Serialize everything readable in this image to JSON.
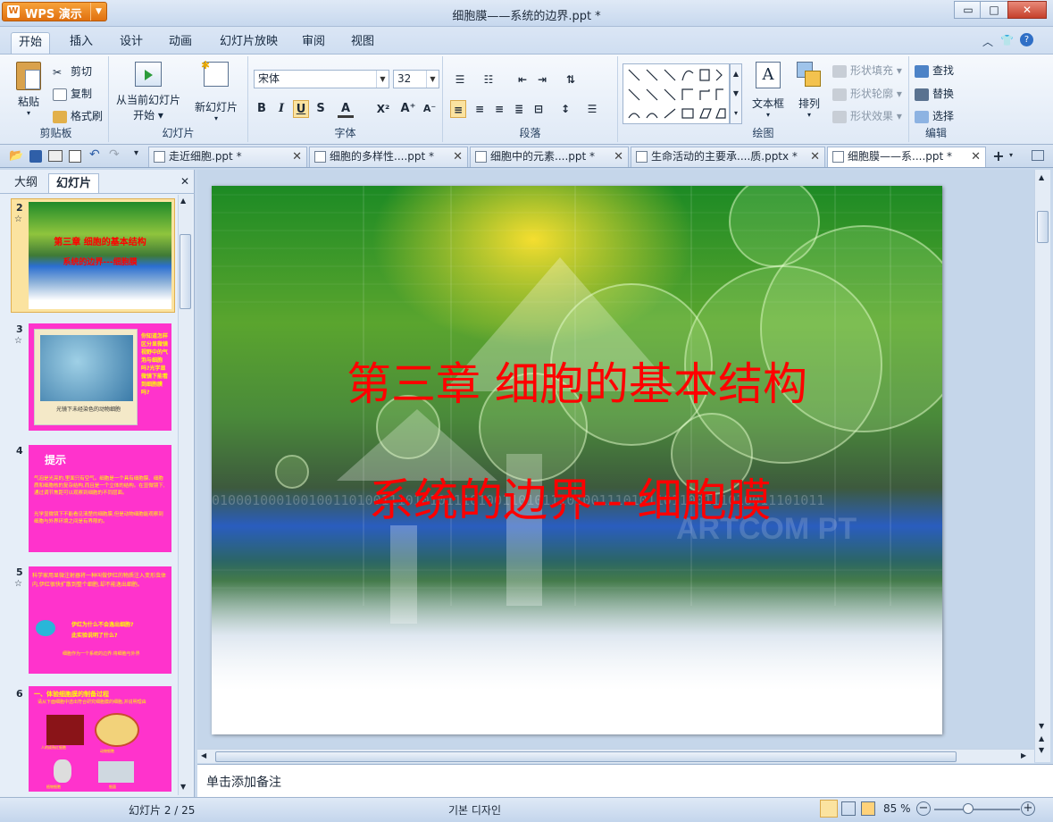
{
  "app": {
    "menu_label": "WPS 演示",
    "logo_letter": "W",
    "title": "细胞膜——系统的边界.ppt *"
  },
  "window_controls": {
    "minimize": "▭",
    "maximize": "□",
    "close": "✕"
  },
  "ribbon_tabs": [
    "开始",
    "插入",
    "设计",
    "动画",
    "幻灯片放映",
    "审阅",
    "视图"
  ],
  "ribbon": {
    "clipboard": {
      "paste": "粘贴",
      "cut": "剪切",
      "copy": "复制",
      "format_painter": "格式刷",
      "label": "剪贴板"
    },
    "slides": {
      "from_current_1": "从当前幻灯片",
      "from_current_2": "开始",
      "new_slide": "新幻灯片",
      "label": "幻灯片"
    },
    "font": {
      "name": "宋体",
      "size": "32",
      "label": "字体"
    },
    "paragraph": {
      "label": "段落"
    },
    "drawing": {
      "textbox": "文本框",
      "arrange": "排列",
      "shape_fill": "形状填充",
      "shape_outline": "形状轮廓",
      "shape_effect": "形状效果",
      "label": "绘图"
    },
    "editing": {
      "find": "查找",
      "replace": "替换",
      "select": "选择",
      "label": "编辑"
    }
  },
  "doc_tabs": [
    {
      "label": "走近细胞.ppt *",
      "active": false
    },
    {
      "label": "细胞的多样性....ppt *",
      "active": false
    },
    {
      "label": "细胞中的元素....ppt *",
      "active": false
    },
    {
      "label": "生命活动的主要承....质.pptx *",
      "active": false
    },
    {
      "label": "细胞膜——系....ppt *",
      "active": true
    }
  ],
  "left_panel": {
    "tabs": [
      "大纲",
      "幻灯片"
    ],
    "thumbnails": [
      {
        "num": "2",
        "line1": "第三章  细胞的基本结构",
        "line2": "系统的边界---细胞膜"
      },
      {
        "num": "3",
        "caption": "光镜下未经染色的动物细胞",
        "side_text": "你知道怎样区分显微镜视野中的气泡与细胞吗?光学显微镜下能看到细胞膜吗?"
      },
      {
        "num": "4",
        "title": "提示",
        "body1": "气泡是光亮的,里面只有空气。细胞是一个具有细胞膜、细胞质和细胞核的复杂结构,而且是一个立体的结构。在显微镜下,通过调节焦距可以观察到细胞的不同层面。",
        "body2": "光学显微镜下不能看见清楚的细胞膜,但是动物细胞能观察到细胞与外界环境之间是有界限的。"
      },
      {
        "num": "5",
        "body": "科学家用显微注射器将一种叫做伊红的物质注入变形虫体内,伊红很快扩散到整个细胞,却不能逸出细胞。",
        "q1": "伊红为什么不会逸出细胞?",
        "q2": "此实验说明了什么?",
        "answer": "细胞作为一个系统的边界:将细胞与外界"
      },
      {
        "num": "6",
        "title": "一、体验细胞膜的制备过程",
        "sub": "请从下面细胞中选出符合研究细胞膜的细胞,并说明理由",
        "labels": [
          "人的成熟红细胞",
          "动物细胞",
          "植物细胞",
          "细菌"
        ]
      }
    ]
  },
  "slide": {
    "title_line1": "第三章  细胞的基本结构",
    "title_line2": "系统的边界---细胞膜",
    "bg_binary": "0100010001001001101001110101011101001101011101001110101101100111010011101011",
    "watermark": "ARTCOM PT"
  },
  "notes": {
    "placeholder": "单击添加备注"
  },
  "status": {
    "slide_info": "幻灯片 2 / 25",
    "design": "기본 디자인",
    "zoom": "85 %"
  },
  "colors": {
    "title_red": "#ff0000",
    "thumb_magenta": "#ff33cc",
    "ribbon_bg": "#dfe9f6"
  }
}
